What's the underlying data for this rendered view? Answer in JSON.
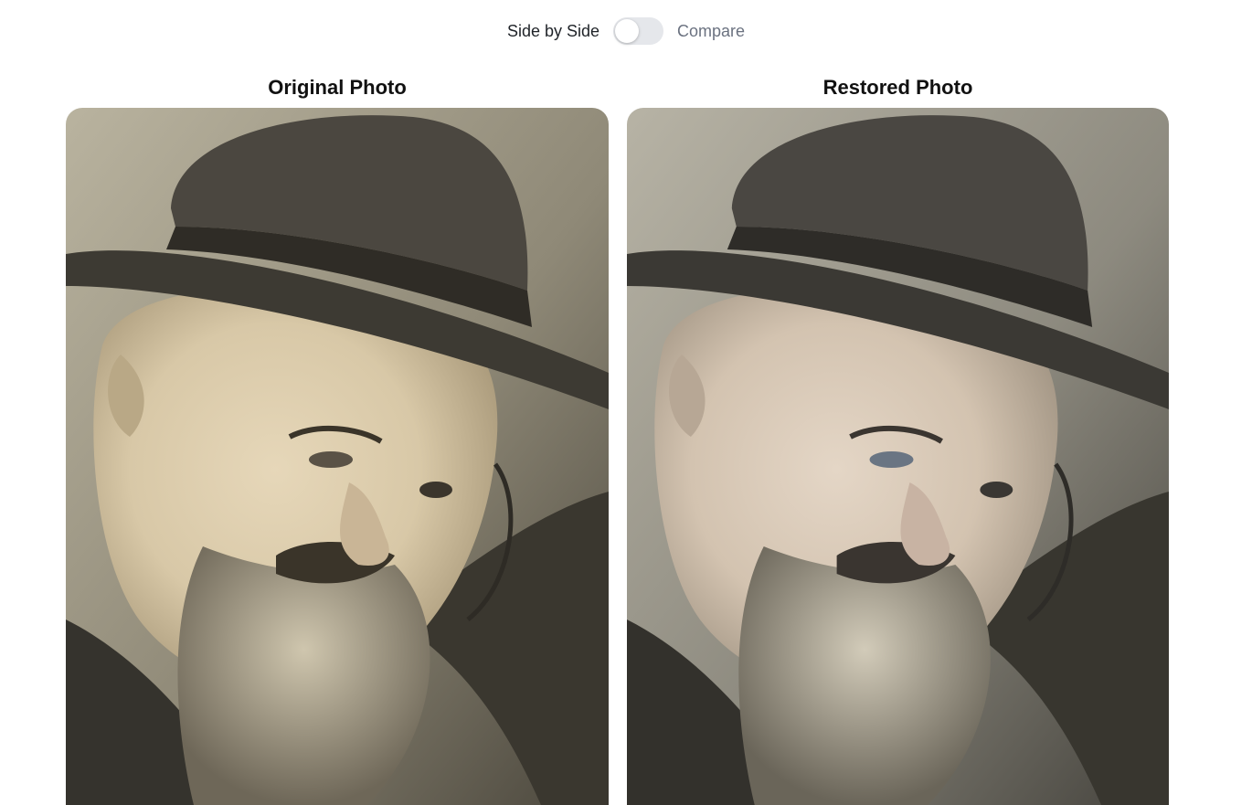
{
  "toggle": {
    "left_label": "Side by Side",
    "right_label": "Compare",
    "state": "off"
  },
  "panels": [
    {
      "title": "Original Photo",
      "tone": "sepia"
    },
    {
      "title": "Restored Photo",
      "tone": "restored"
    }
  ],
  "colors": {
    "switch_track": "#e5e7eb",
    "switch_knob": "#ffffff",
    "muted_text": "#6b7280"
  }
}
